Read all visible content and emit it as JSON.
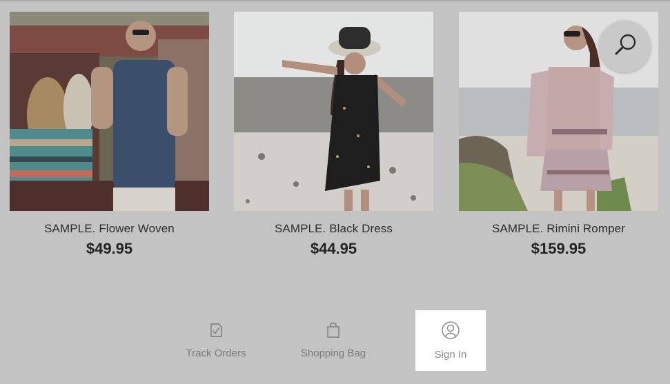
{
  "products": [
    {
      "name": "SAMPLE. Flower Woven",
      "price": "$49.95",
      "image": "man-by-vintage-truck-photo"
    },
    {
      "name": "SAMPLE. Black Dress",
      "price": "$44.95",
      "image": "woman-black-dress-beach-photo"
    },
    {
      "name": "SAMPLE. Rimini Romper",
      "price": "$159.95",
      "image": "woman-romper-coast-photo"
    }
  ],
  "search": {
    "icon": "search-icon"
  },
  "footer_nav": {
    "items": [
      {
        "label": "Track Orders",
        "icon": "clipboard-check-icon",
        "active": false
      },
      {
        "label": "Shopping Bag",
        "icon": "shopping-bag-icon",
        "active": false
      },
      {
        "label": "Sign In",
        "icon": "user-circle-icon",
        "active": true
      }
    ]
  },
  "colors": {
    "overlay_background": "#c3c3c3",
    "active_tab_background": "#ffffff",
    "price_text": "#242424"
  }
}
